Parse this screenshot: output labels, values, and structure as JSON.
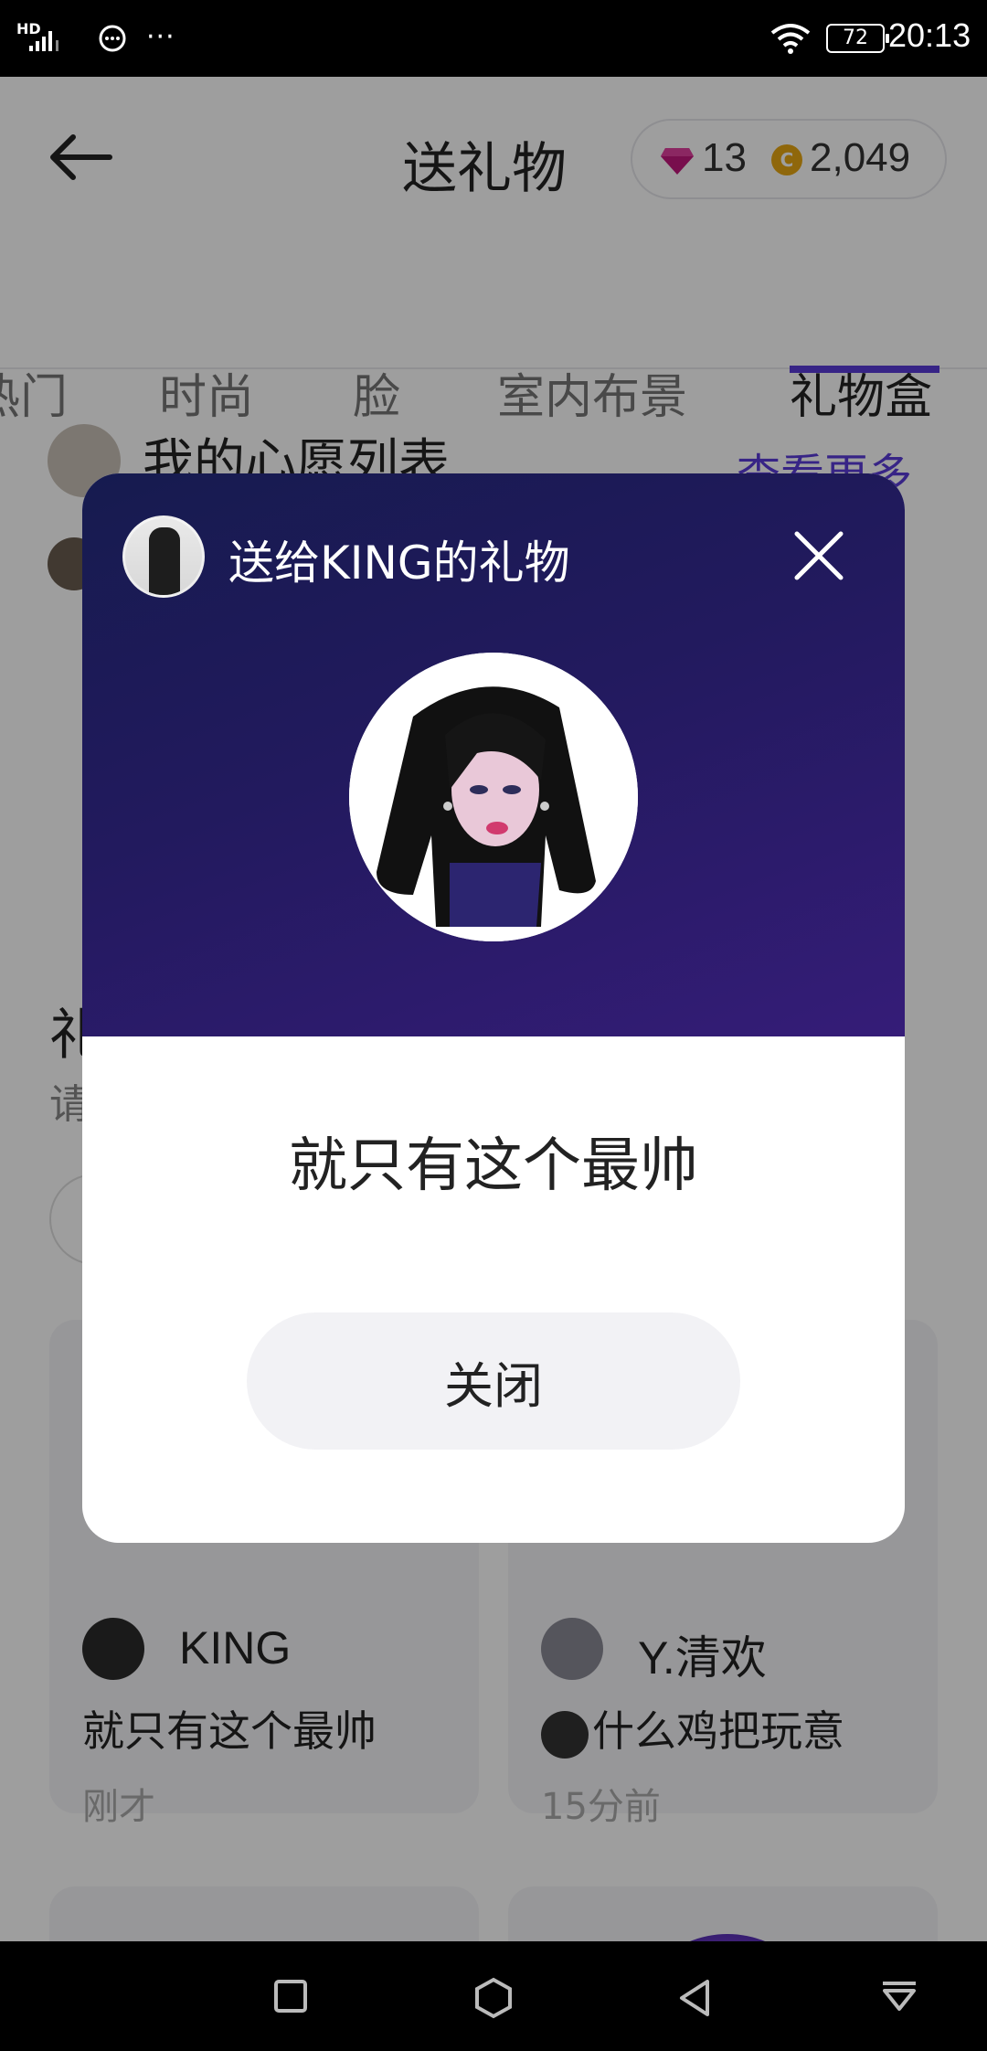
{
  "status_bar": {
    "network_label": "HD",
    "battery": "72",
    "time": "20:13"
  },
  "header": {
    "title": "送礼物",
    "gems": "13",
    "coin_symbol": "C",
    "coins": "2,049"
  },
  "tabs": [
    {
      "label": "热门"
    },
    {
      "label": "时尚"
    },
    {
      "label": "脸"
    },
    {
      "label": "室内布景"
    },
    {
      "label": "礼物盒"
    }
  ],
  "wishlist": {
    "title": "我的心愿列表",
    "more": "查看更多"
  },
  "section": {
    "title_char": "礼",
    "subtitle_char": "请"
  },
  "feed": [
    {
      "name": "KING",
      "message": "就只有这个最帅",
      "time": "刚才"
    },
    {
      "name": "Y.清欢",
      "message": "什么鸡把玩意",
      "time": "15分前"
    }
  ],
  "dialog": {
    "title": "送给KING的礼物",
    "message": "就只有这个最帅",
    "close_label": "关闭"
  },
  "colors": {
    "accent": "#5a3ad8",
    "dialog_gradient_start": "#161b4f",
    "dialog_gradient_end": "#351c78"
  }
}
